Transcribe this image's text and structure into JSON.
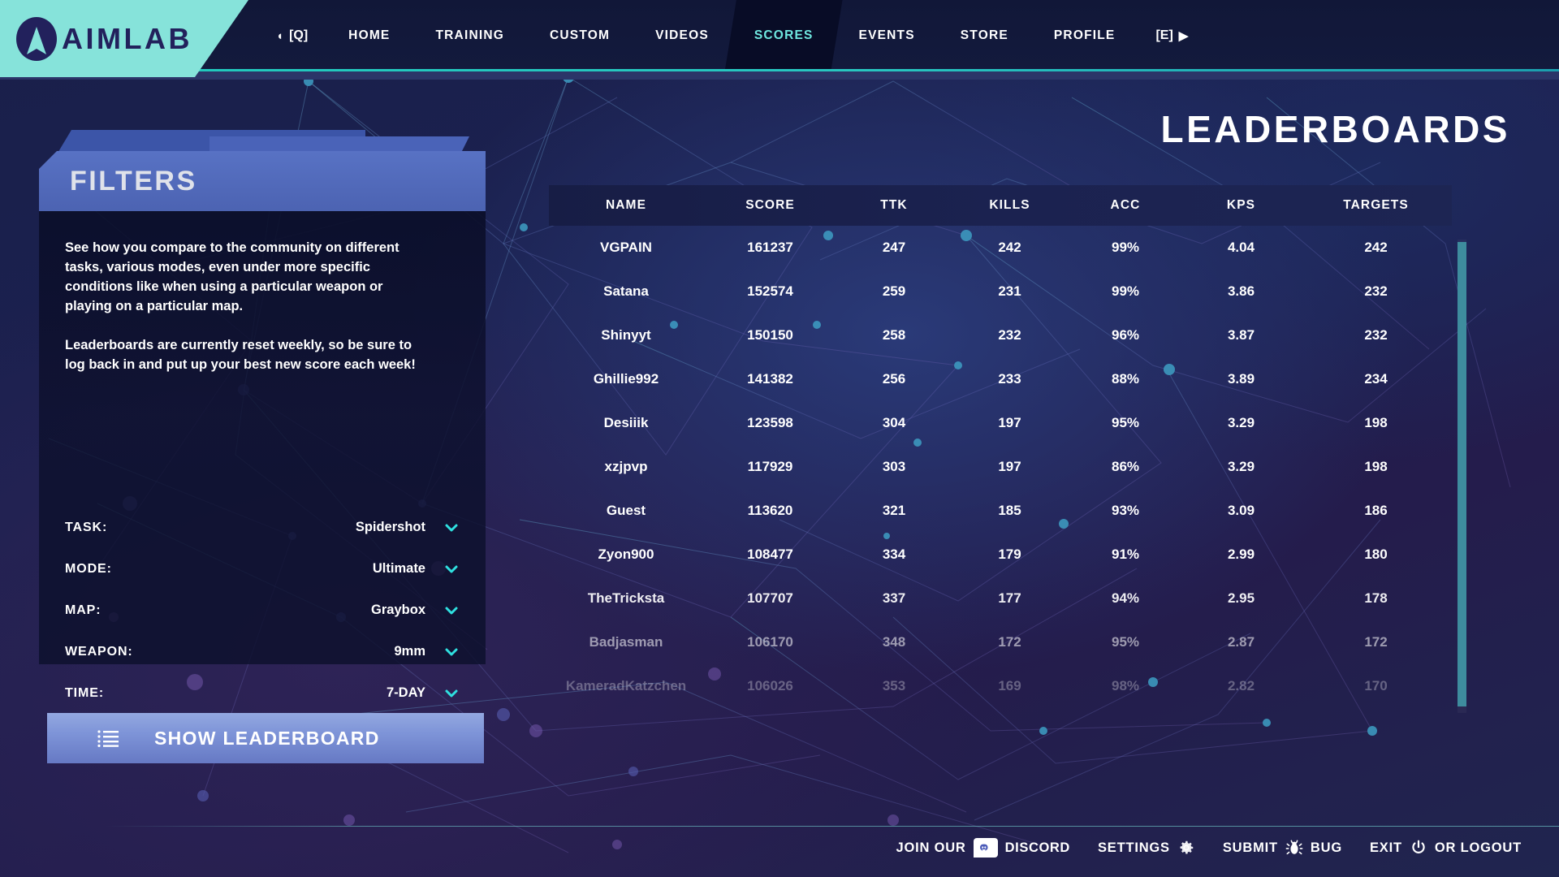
{
  "app": {
    "logo_text": "AIMLAB",
    "page_title": "LEADERBOARDS"
  },
  "nav": {
    "left_key": "[Q]",
    "right_key": "[E]",
    "items": [
      {
        "label": "HOME",
        "active": false
      },
      {
        "label": "TRAINING",
        "active": false
      },
      {
        "label": "CUSTOM",
        "active": false
      },
      {
        "label": "VIDEOS",
        "active": false
      },
      {
        "label": "SCORES",
        "active": true
      },
      {
        "label": "EVENTS",
        "active": false
      },
      {
        "label": "STORE",
        "active": false
      },
      {
        "label": "PROFILE",
        "active": false
      }
    ],
    "accent_active": "#6fe8e0",
    "underline_color": "#28c6c0"
  },
  "filters": {
    "title": "FILTERS",
    "description_1": "See how you compare to the community on different tasks, various  modes, even under more specific conditions like when using a particular weapon or playing on a particular map.",
    "description_2": "Leaderboards are currently reset weekly, so be sure to log back in and put up your best new score each week!",
    "rows": [
      {
        "label": "TASK:",
        "value": "Spidershot",
        "icon": "chevron-down-icon"
      },
      {
        "label": "MODE:",
        "value": "Ultimate",
        "icon": "chevron-down-icon"
      },
      {
        "label": "MAP:",
        "value": "Graybox",
        "icon": "chevron-down-icon"
      },
      {
        "label": "WEAPON:",
        "value": "9mm",
        "icon": "chevron-down-icon"
      },
      {
        "label": "TIME:",
        "value": "7-DAY",
        "icon": "chevron-down-icon"
      }
    ],
    "show_button": {
      "label": "SHOW LEADERBOARD",
      "icon": "list-icon"
    },
    "header_color": "#4c63b2",
    "chevron_color": "#2fe0e0"
  },
  "leaderboard": {
    "columns": [
      "NAME",
      "SCORE",
      "TTK",
      "KILLS",
      "ACC",
      "KPS",
      "TARGETS"
    ],
    "rows": [
      {
        "name": "VGPAIN",
        "score": "161237",
        "ttk": "247",
        "kills": "242",
        "acc": "99%",
        "kps": "4.04",
        "targets": "242",
        "opacity": 1.0
      },
      {
        "name": "Satana",
        "score": "152574",
        "ttk": "259",
        "kills": "231",
        "acc": "99%",
        "kps": "3.86",
        "targets": "232",
        "opacity": 1.0
      },
      {
        "name": "Shinyyt",
        "score": "150150",
        "ttk": "258",
        "kills": "232",
        "acc": "96%",
        "kps": "3.87",
        "targets": "232",
        "opacity": 1.0
      },
      {
        "name": "Ghillie992",
        "score": "141382",
        "ttk": "256",
        "kills": "233",
        "acc": "88%",
        "kps": "3.89",
        "targets": "234",
        "opacity": 1.0
      },
      {
        "name": "Desiiik",
        "score": "123598",
        "ttk": "304",
        "kills": "197",
        "acc": "95%",
        "kps": "3.29",
        "targets": "198",
        "opacity": 1.0
      },
      {
        "name": "xzjpvp",
        "score": "117929",
        "ttk": "303",
        "kills": "197",
        "acc": "86%",
        "kps": "3.29",
        "targets": "198",
        "opacity": 1.0
      },
      {
        "name": "Guest",
        "score": "113620",
        "ttk": "321",
        "kills": "185",
        "acc": "93%",
        "kps": "3.09",
        "targets": "186",
        "opacity": 1.0
      },
      {
        "name": "Zyon900",
        "score": "108477",
        "ttk": "334",
        "kills": "179",
        "acc": "91%",
        "kps": "2.99",
        "targets": "180",
        "opacity": 1.0
      },
      {
        "name": "TheTricksta",
        "score": "107707",
        "ttk": "337",
        "kills": "177",
        "acc": "94%",
        "kps": "2.95",
        "targets": "178",
        "opacity": 0.92
      },
      {
        "name": "Badjasman",
        "score": "106170",
        "ttk": "348",
        "kills": "172",
        "acc": "95%",
        "kps": "2.87",
        "targets": "172",
        "opacity": 0.55
      },
      {
        "name": "KameradKatzchen",
        "score": "106026",
        "ttk": "353",
        "kills": "169",
        "acc": "98%",
        "kps": "2.82",
        "targets": "170",
        "opacity": 0.3
      }
    ],
    "scrollbar_color": "#3e8c9e"
  },
  "footer": {
    "join_our": "JOIN OUR",
    "discord": "DISCORD",
    "settings": "SETTINGS",
    "submit": "SUBMIT",
    "bug": "BUG",
    "exit": "EXIT",
    "or_logout": "OR LOGOUT"
  }
}
